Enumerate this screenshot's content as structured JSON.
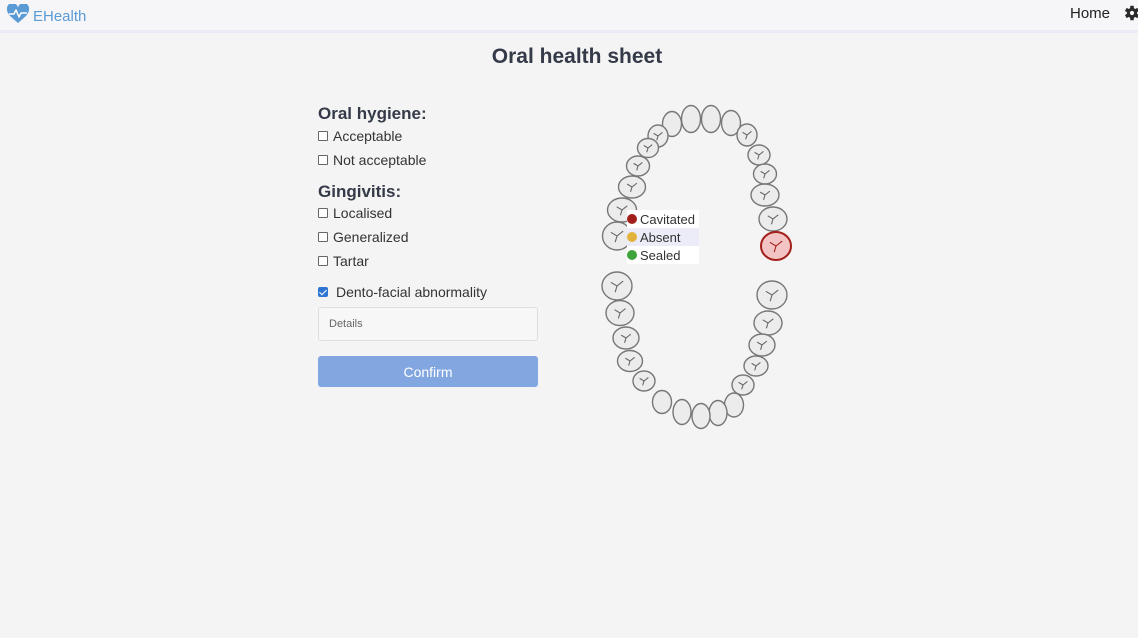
{
  "navbar": {
    "brand": "EHealth",
    "brand_icon": "heart-pulse-icon",
    "home_label": "Home",
    "settings_icon": "gear-icon"
  },
  "page": {
    "title": "Oral health sheet"
  },
  "oral_hygiene": {
    "title": "Oral hygiene:",
    "options": [
      {
        "label": "Acceptable",
        "checked": false
      },
      {
        "label": "Not acceptable",
        "checked": false
      }
    ]
  },
  "gingivitis": {
    "title": "Gingivitis:",
    "options": [
      {
        "label": "Localised",
        "checked": false
      },
      {
        "label": "Generalized",
        "checked": false
      },
      {
        "label": "Tartar",
        "checked": false
      }
    ]
  },
  "abnormality": {
    "label": "Dento-facial abnormality",
    "checked": true
  },
  "details": {
    "placeholder": "Details",
    "value": ""
  },
  "confirm": {
    "label": "Confirm"
  },
  "tooth_chart": {
    "selected_tooth_status": "Cavitated",
    "legend": [
      {
        "label": "Cavitated",
        "color": "#a31f1a"
      },
      {
        "label": "Absent",
        "color": "#e2b33c"
      },
      {
        "label": "Sealed",
        "color": "#3ea33a"
      }
    ]
  },
  "colors": {
    "accent": "#5b9bd5",
    "button": "#82a7e0",
    "checkbox": "#2f76d2",
    "tooth_fill": "#ececec",
    "tooth_stroke": "#777777",
    "cavitated_fill": "#f2c4c4",
    "cavitated_stroke": "#a31f1a"
  }
}
